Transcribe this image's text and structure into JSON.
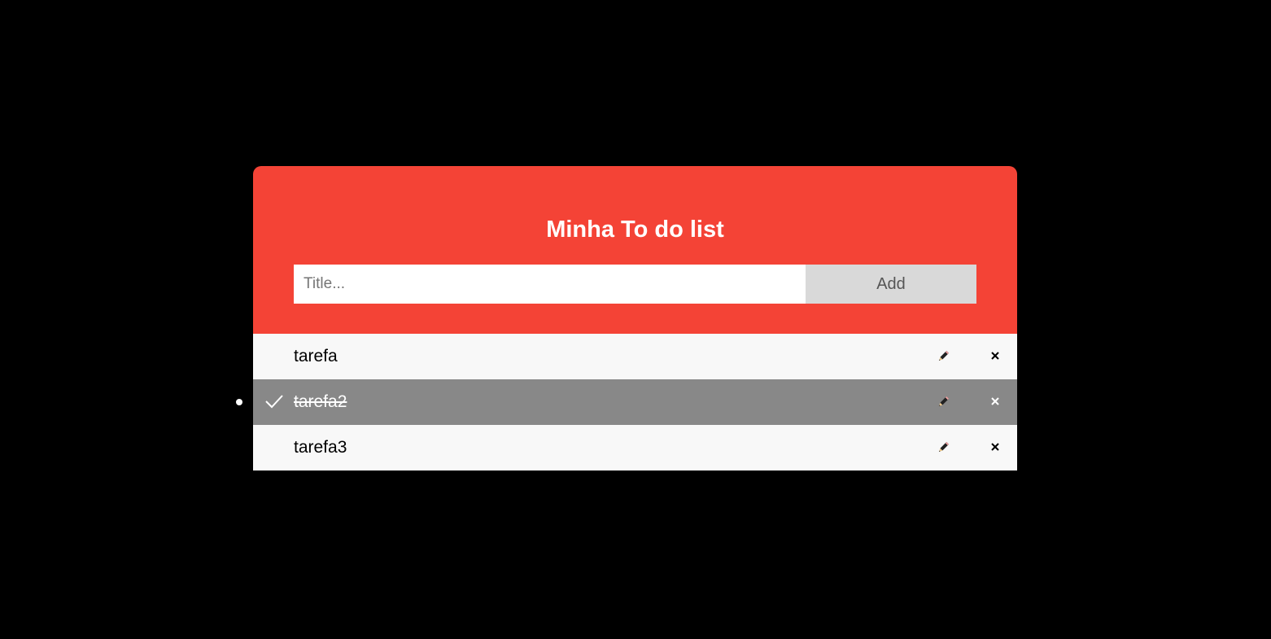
{
  "app": {
    "title": "Minha To do list"
  },
  "add_form": {
    "placeholder": "Title...",
    "value": "",
    "button_label": "Add"
  },
  "todos": [
    {
      "label": "tarefa",
      "checked": false
    },
    {
      "label": "tarefa2",
      "checked": true
    },
    {
      "label": "tarefa3",
      "checked": false
    }
  ],
  "icons": {
    "edit": "pencil-icon",
    "delete": "close-icon",
    "done": "check-icon"
  },
  "colors": {
    "header_bg": "#f44336",
    "checked_bg": "#888888",
    "item_bg": "#f8f8f8",
    "add_button_bg": "#d9d9d9",
    "page_bg": "#000000"
  }
}
